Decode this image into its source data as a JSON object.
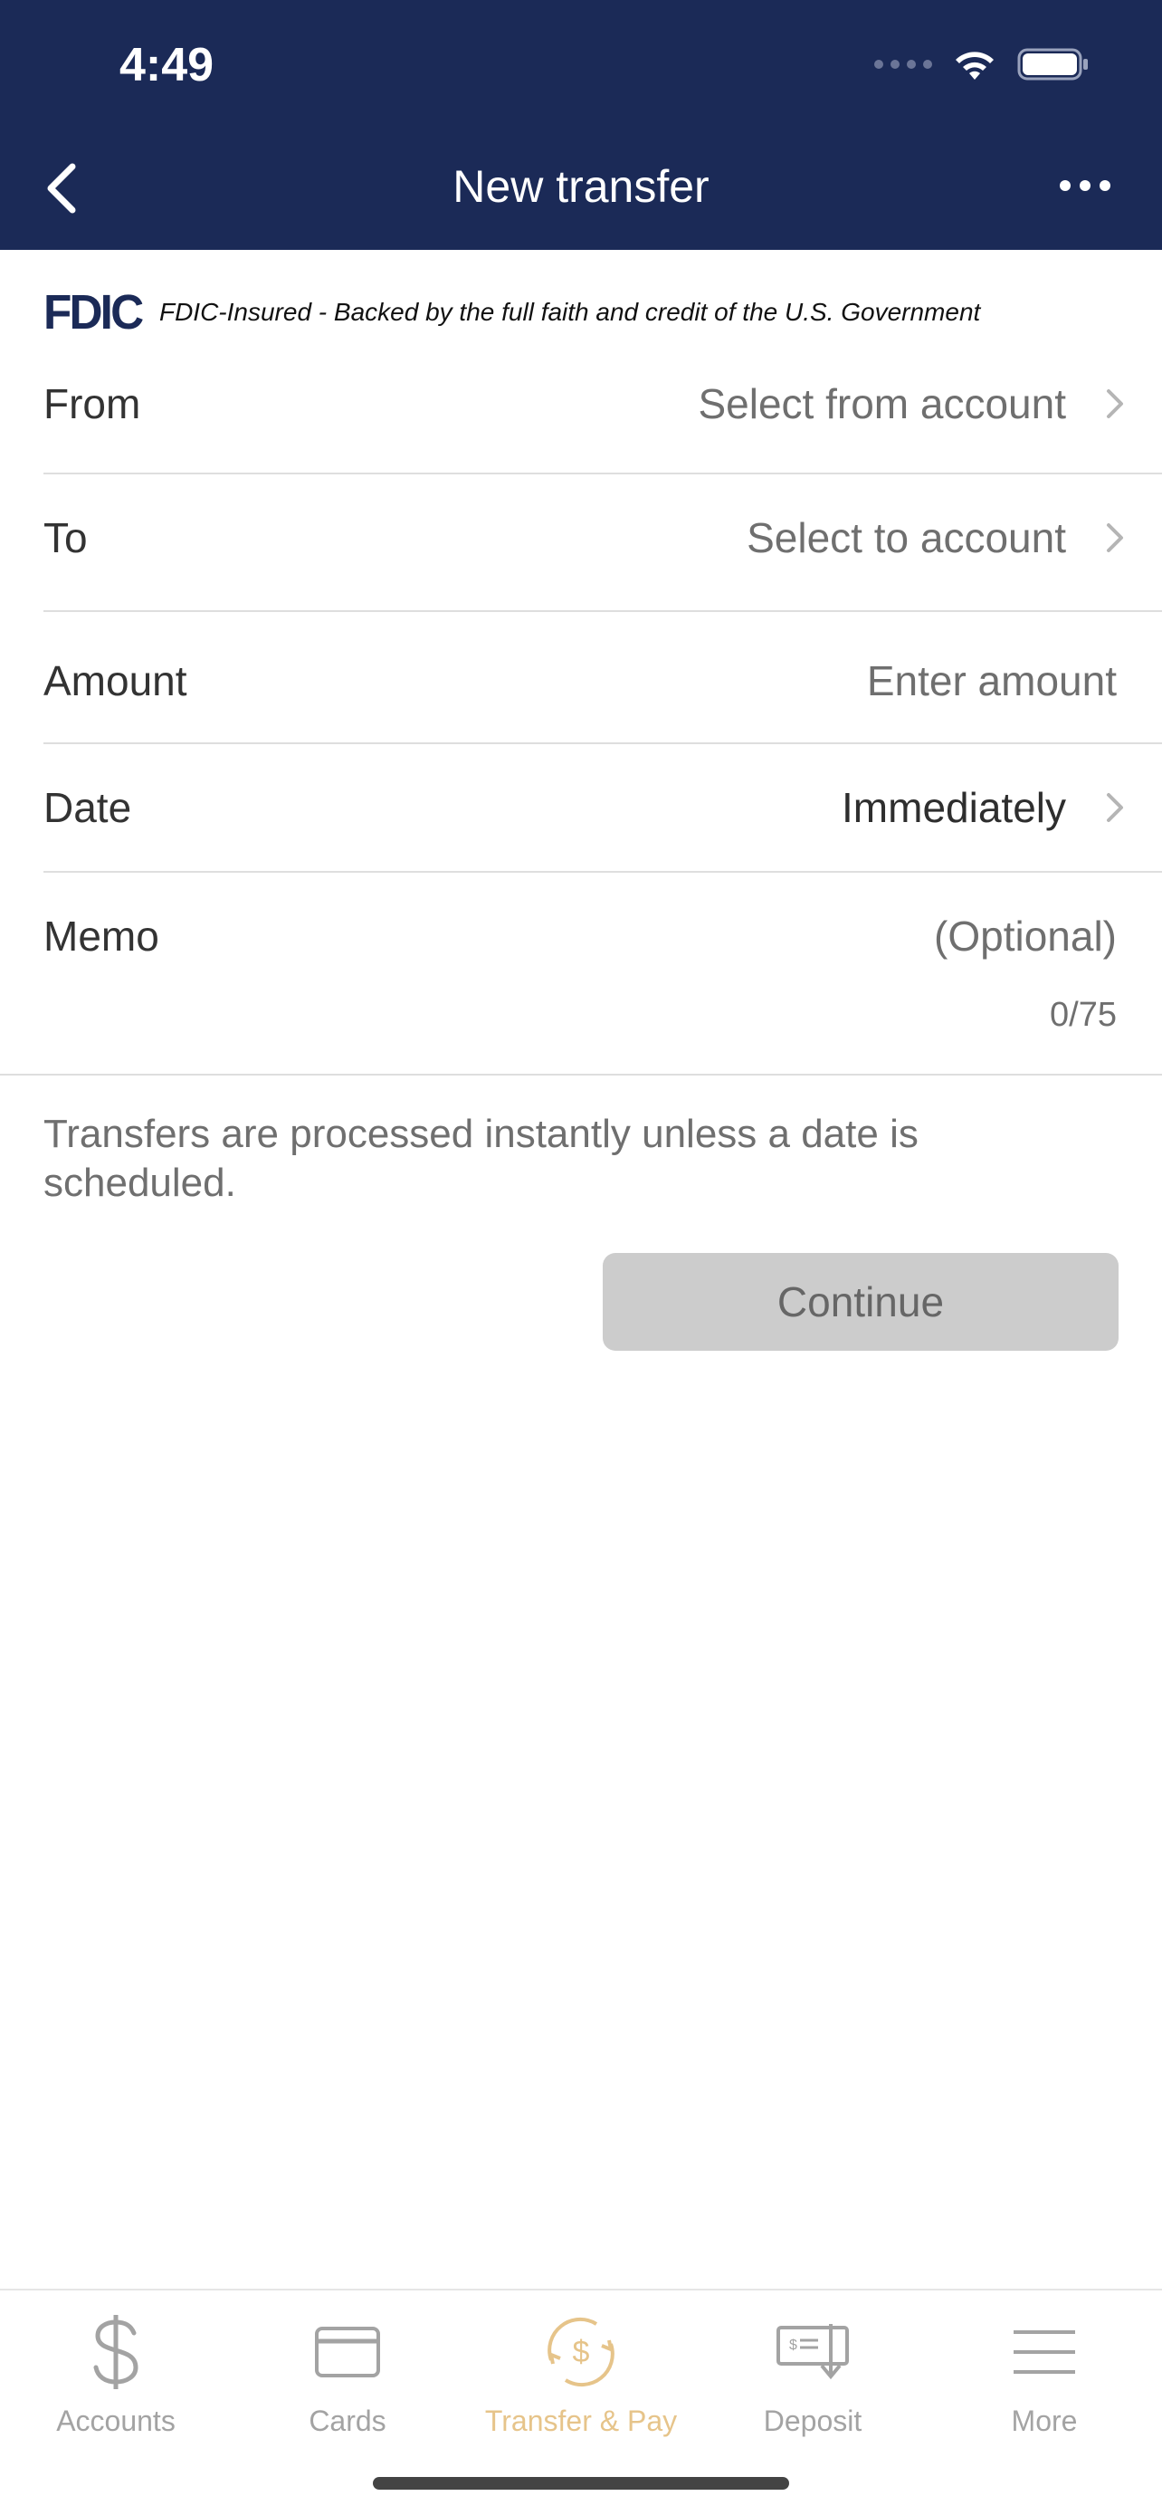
{
  "status_bar": {
    "time": "4:49"
  },
  "header": {
    "title": "New transfer"
  },
  "fdic": {
    "logo": "FDIC",
    "text": "FDIC-Insured - Backed by the full faith and credit of the U.S. Government"
  },
  "form": {
    "from": {
      "label": "From",
      "placeholder": "Select from account"
    },
    "to": {
      "label": "To",
      "placeholder": "Select to account"
    },
    "amount": {
      "label": "Amount",
      "placeholder": "Enter amount"
    },
    "date": {
      "label": "Date",
      "value": "Immediately"
    },
    "memo": {
      "label": "Memo",
      "placeholder": "(Optional)",
      "counter": "0/75"
    }
  },
  "note": "Transfers are processed instantly unless a date is scheduled.",
  "continue_label": "Continue",
  "tabs": [
    {
      "label": "Accounts",
      "icon": "dollar-icon"
    },
    {
      "label": "Cards",
      "icon": "card-icon"
    },
    {
      "label": "Transfer & Pay",
      "icon": "transfer-pay-icon",
      "active": true
    },
    {
      "label": "Deposit",
      "icon": "check-deposit-icon"
    },
    {
      "label": "More",
      "icon": "menu-icon"
    }
  ],
  "colors": {
    "header": "#1b2a57",
    "active_tab": "#e6c48a",
    "inactive_tab": "#a3a3a3",
    "button_disabled": "#cccccc"
  }
}
